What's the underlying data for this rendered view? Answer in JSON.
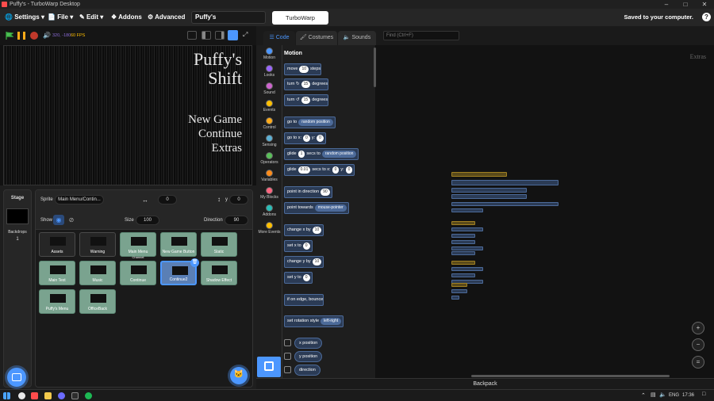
{
  "window": {
    "title": "Puffy's - TurboWarp Desktop"
  },
  "menu": {
    "settings": "Settings",
    "file": "File",
    "edit": "Edit",
    "addons": "Addons",
    "advanced": "Advanced",
    "project_title": "Puffy's",
    "feedback": "TurboWarp Feedback",
    "saved": "Saved to your computer."
  },
  "stage_controls": {
    "stats": "320, -180",
    "fps": "60 FPS"
  },
  "stage_screen": {
    "title_line1": "Puffy's",
    "title_line2": "Shift",
    "menu": [
      "New Game",
      "Continue",
      "Extras"
    ]
  },
  "stage_panel": {
    "label": "Stage",
    "backdrops_label": "Backdrops",
    "backdrops_count": "1"
  },
  "sprite_info": {
    "sprite_label": "Sprite",
    "sprite_name": "Main Menu/Contin...",
    "x_label": "x",
    "x_value": "0",
    "y_label": "y",
    "y_value": "0",
    "show_label": "Show",
    "size_label": "Size",
    "size_value": "100",
    "direction_label": "Direction",
    "direction_value": "90"
  },
  "sprites": [
    {
      "name": "Assets",
      "style": "dark"
    },
    {
      "name": "Warning",
      "style": "dark"
    },
    {
      "name": "Main Menu",
      "sub": "Channel",
      "style": "green"
    },
    {
      "name": "New Game Button",
      "style": "green"
    },
    {
      "name": "Static",
      "style": "green"
    },
    {
      "name": "Main Text",
      "style": "green"
    },
    {
      "name": "Music",
      "style": "green"
    },
    {
      "name": "Continue",
      "style": "green"
    },
    {
      "name": "Continue2",
      "style": "selected"
    },
    {
      "name": "Shadow Effect",
      "style": "green"
    },
    {
      "name": "Puffy's Menu",
      "style": "green"
    },
    {
      "name": "OfficeBack",
      "style": "green"
    }
  ],
  "tabs": {
    "code": "Code",
    "costumes": "Costumes",
    "sounds": "Sounds",
    "find_placeholder": "Find (Ctrl+F)"
  },
  "categories": [
    {
      "label": "Motion",
      "color": "#4c97ff"
    },
    {
      "label": "Looks",
      "color": "#9966ff"
    },
    {
      "label": "Sound",
      "color": "#cf63cf"
    },
    {
      "label": "Events",
      "color": "#ffbf00"
    },
    {
      "label": "Control",
      "color": "#ffab19"
    },
    {
      "label": "Sensing",
      "color": "#5cb1d6"
    },
    {
      "label": "Operators",
      "color": "#59c059"
    },
    {
      "label": "Variables",
      "color": "#ff8c1a"
    },
    {
      "label": "My Blocks",
      "color": "#ff6680"
    },
    {
      "label": "Addons",
      "color": "#29beb8"
    },
    {
      "label": "More Events",
      "color": "#ffbf00"
    }
  ],
  "palette": {
    "heading": "Motion",
    "move": {
      "a": "move",
      "n": "10",
      "b": "steps"
    },
    "turn_right": {
      "a": "turn",
      "n": "15",
      "b": "degrees"
    },
    "turn_left": {
      "a": "turn",
      "n": "15",
      "b": "degrees"
    },
    "goto": {
      "a": "go to",
      "dd": "random position"
    },
    "goto_xy": {
      "a": "go to x:",
      "x": "0",
      "b": "y:",
      "y": "0"
    },
    "glide_to": {
      "a": "glide",
      "n": "1",
      "b": "secs to",
      "dd": "random position"
    },
    "glide_xy": {
      "a": "glide",
      "n": "0.01",
      "b": "secs to x:",
      "x": "0",
      "c": "y:",
      "y": "0"
    },
    "point_dir": {
      "a": "point in direction",
      "n": "90"
    },
    "point_towards": {
      "a": "point towards",
      "dd": "mouse-pointer"
    },
    "change_x": {
      "a": "change x by",
      "n": "10"
    },
    "set_x": {
      "a": "set x to",
      "n": "0"
    },
    "change_y": {
      "a": "change y by",
      "n": "10"
    },
    "set_y": {
      "a": "set y to",
      "n": "0"
    },
    "bounce": "if on edge, bounce",
    "rotation": {
      "a": "set rotation style",
      "dd": "left-right"
    },
    "reporters": [
      "x position",
      "y position",
      "direction"
    ]
  },
  "workspace": {
    "sprite_label": "Extras"
  },
  "backpack": "Backpack",
  "taskbar": {
    "lang": "ENG",
    "time": "17:36"
  }
}
